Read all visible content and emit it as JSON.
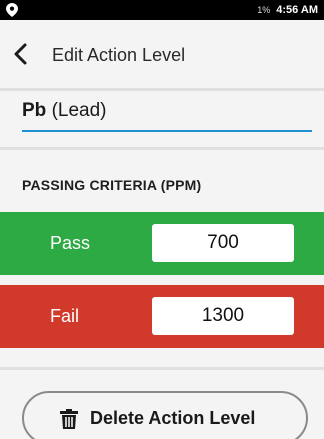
{
  "status_bar": {
    "left_icon": "location-pin-icon",
    "battery": "1%",
    "time": "4:56 AM"
  },
  "header": {
    "back_icon": "chevron-left-icon",
    "title": "Edit Action Level"
  },
  "element": {
    "symbol": "Pb",
    "name": "(Lead)"
  },
  "criteria": {
    "label": "PASSING CRITERIA (PPM)",
    "pass": {
      "label": "Pass",
      "value": "700",
      "color": "#2eaa44"
    },
    "fail": {
      "label": "Fail",
      "value": "1300",
      "color": "#d13a2b"
    }
  },
  "actions": {
    "delete_icon": "trash-icon",
    "delete_label": "Delete Action Level"
  },
  "colors": {
    "accent": "#1e8fd1"
  }
}
